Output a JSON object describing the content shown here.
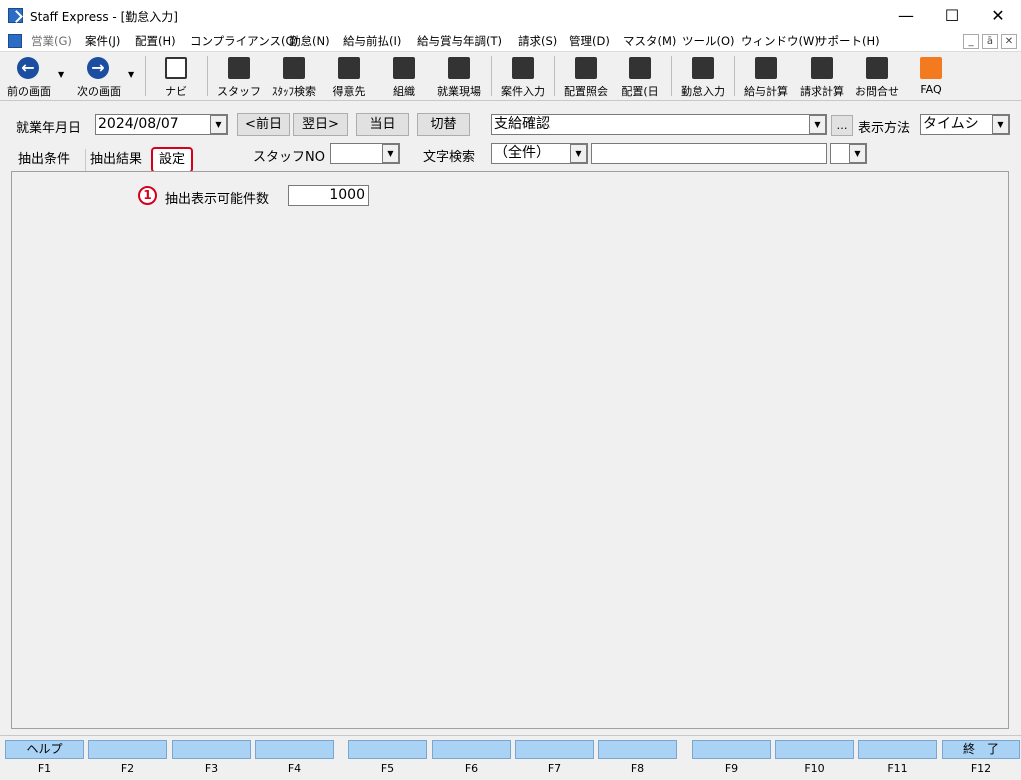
{
  "window": {
    "title": "Staff Express - [勤怠入力]",
    "minimize": "—",
    "maximize": "☐",
    "close": "✕"
  },
  "menu": {
    "items": [
      "営業(G)",
      "案件(J)",
      "配置(H)",
      "コンプライアンス(C)",
      "勤怠(N)",
      "給与前払(I)",
      "給与賞与年調(T)",
      "請求(S)",
      "管理(D)",
      "マスタ(M)",
      "ツール(O)",
      "ウィンドウ(W)",
      "サポート(H)"
    ],
    "mdi_min": "_",
    "mdi_restore": "ā",
    "mdi_close": "✕"
  },
  "toolbar": {
    "back": "前の画面",
    "forward": "次の画面",
    "navi": "ナビ",
    "staff": "スタッフ",
    "staff_search": "ｽﾀｯﾌ検索",
    "client": "得意先",
    "org": "組織",
    "site": "就業現場",
    "case_input": "案件入力",
    "assign_inquiry": "配置照会",
    "assign_day": "配置(日",
    "attendance_input": "勤怠入力",
    "payroll": "給与計算",
    "billing": "請求計算",
    "contact": "お問合せ",
    "faq": "FAQ"
  },
  "form": {
    "work_date_label": "就業年月日",
    "work_date_value": "2024/08/07",
    "prev_day": "<前日",
    "next_day": "翌日>",
    "today": "当日",
    "switch": "切替",
    "mode_value": "支給確認",
    "ellipsis": "…",
    "display_method_label": "表示方法",
    "display_method_value": "タイムシ",
    "staff_no_label": "スタッフNO",
    "staff_no_value": "",
    "text_search_label": "文字検索",
    "text_search_scope": "（全件）",
    "text_search_value": ""
  },
  "tabs": {
    "items": [
      "抽出条件",
      "抽出結果",
      "設定"
    ],
    "active": "設定"
  },
  "settings": {
    "marker": "1",
    "max_rows_label": "抽出表示可能件数",
    "max_rows_value": "1000"
  },
  "fkeys": {
    "buttons": [
      "ヘルプ",
      "",
      "",
      "",
      "",
      "",
      "",
      "",
      "",
      "",
      "",
      "終　了"
    ],
    "labels": [
      "F1",
      "F2",
      "F3",
      "F4",
      "F5",
      "F6",
      "F7",
      "F8",
      "F9",
      "F10",
      "F11",
      "F12"
    ]
  },
  "colors": {
    "fkey_fill": "#a9d2f4",
    "highlight_red": "#d6001c",
    "nav_blue": "#1b4ea0",
    "faq_orange": "#f47a20"
  }
}
